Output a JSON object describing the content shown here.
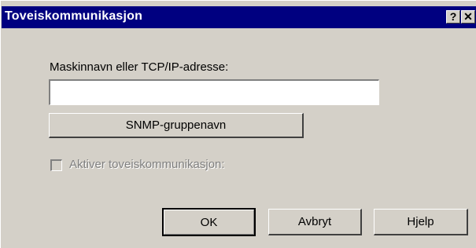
{
  "window": {
    "title": "Toveiskommunikasjon",
    "help_button": "?",
    "close_button": "✕"
  },
  "form": {
    "host_label": "Maskinnavn eller TCP/IP-adresse:",
    "host_value": "",
    "snmp_button": "SNMP-gruppenavn",
    "enable_checkbox_label": "Aktiver toveiskommunikasjon:",
    "enable_checkbox_checked": false,
    "enable_checkbox_disabled": true
  },
  "buttons": {
    "ok": "OK",
    "cancel": "Avbryt",
    "help": "Hjelp"
  },
  "colors": {
    "titlebar": "#000080",
    "dialog_bg": "#d4d0c8",
    "disabled_text": "#808080"
  }
}
